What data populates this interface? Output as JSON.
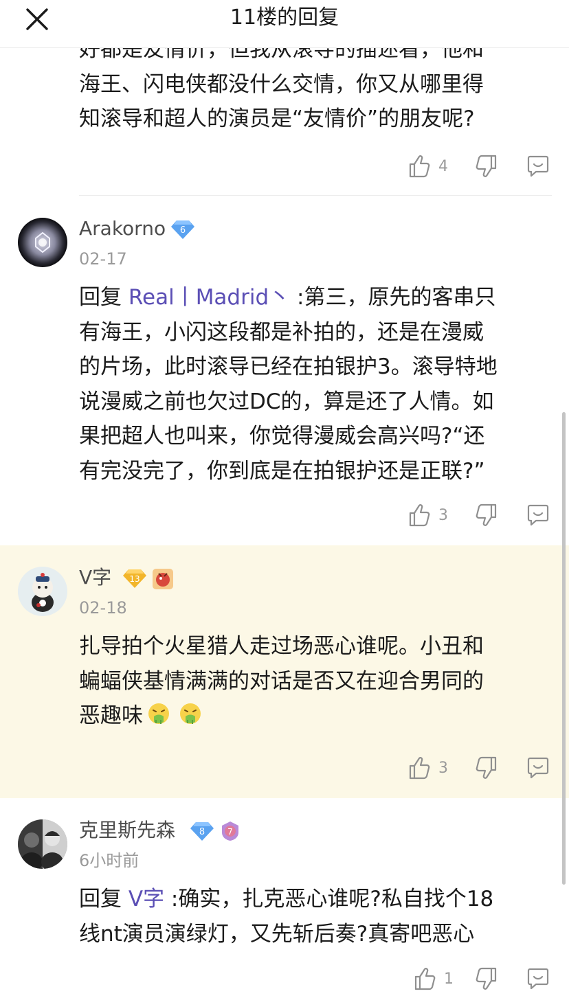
{
  "header": {
    "title": "11楼的回复",
    "close_icon": "close-icon"
  },
  "comments": [
    {
      "partial": true,
      "text_lines": [
        "好都是友情价，但我从滚导的描述看，他和",
        "海王、闪电侠都没什么交情，你又从哪里得",
        "知滚导和超人的演员是“友情价”的朋友呢?"
      ],
      "likes": "4"
    },
    {
      "username": "Arakorno",
      "level": "6",
      "date": "02-17",
      "reply_prefix": "回复 ",
      "reply_to": "Real丨Madrid丶",
      "line1_rest": " :第三，原先的客串只",
      "text_lines": [
        "有海王，小闪这段都是补拍的，还是在漫威",
        "的片场，此时滚导已经在拍银护3。滚导特地",
        "说漫威之前也欠过DC的，算是还了人情。如",
        "果把超人也叫来，你觉得漫威会高兴吗?“还",
        "有完没完了，你到底是在拍银护还是正联?”"
      ],
      "likes": "3"
    },
    {
      "username": "V字",
      "level": "13",
      "date": "02-18",
      "text_lines": [
        "扎导拍个火星猎人走过场恶心谁呢。小丑和",
        "蝙蝠侠基情满满的对话是否又在迎合男同的",
        "恶趣味"
      ],
      "emoji": "vomit-emoji",
      "likes": "3",
      "highlight_color": "#fcf8e6"
    },
    {
      "username": "克里斯先森",
      "level": "8",
      "medal": "7",
      "date": "6小时前",
      "reply_prefix": "回复 ",
      "reply_to": "V字",
      "line1_rest": " :确实，扎克恶心谁呢?私自找个18",
      "text_lines": [
        "线nt演员演绿灯，又先斩后奏?真寄吧恶心"
      ],
      "likes": "1"
    }
  ],
  "colors": {
    "accent_link": "#5b4fb5",
    "badge_blue": "#5aa2f0",
    "badge_gold": "#f2b52a",
    "highlight_bg": "#fcf8e6",
    "muted": "#9a9a9a"
  }
}
